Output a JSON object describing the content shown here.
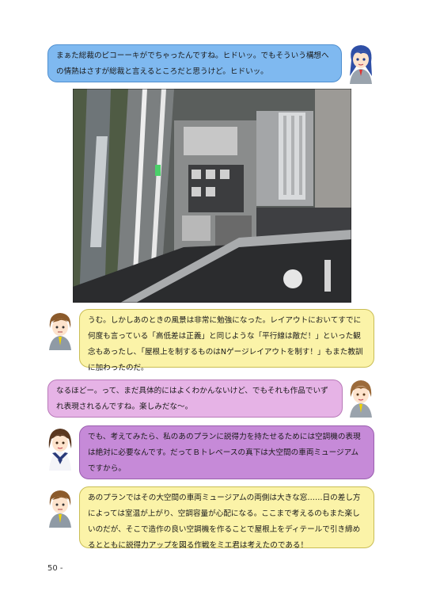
{
  "dialogs": [
    {
      "id": "d1",
      "text": "まぁた総裁のピコーーキがでちゃったんですね。ヒドいッ。でもそういう構想への情熱はさすが総裁と言えるところだと思うけど。ヒドいッ。",
      "speaker": "blue-hair-girl"
    },
    {
      "id": "d2",
      "text": "うむ。しかしあのときの風景は非常に勉強になった。レイアウトにおいてすでに何度も言っている「高低差は正義」と同じような「平行線は敵だ！」といった観念もあったし、「屋根上を制するものはNゲージレイアウトを制す！」もまた教訓に加わったのだ。",
      "speaker": "brown-hair-man"
    },
    {
      "id": "d3",
      "text": "なるほどー。って、まだ具体的にはよくわかんないけど、でもそれも作品でいずれ表現されるんですね。楽しみだな〜。",
      "speaker": "short-hair-girl"
    },
    {
      "id": "d4",
      "text": "でも、考えてみたら、私のあのプランに説得力を持たせるためには空調機の表現は絶対に必要なんです。だってＢトレベースの真下は大空間の車両ミュージアムですから。",
      "speaker": "sailor-uniform-girl"
    },
    {
      "id": "d5",
      "text": "あのプランではその大空間の車両ミュージアムの両側は大きな窓……日の差し方によっては室温が上がり、空調容量が心配になる。ここまで考えるのもまた楽しいのだが、そこで造作の良い空調機を作ることで屋根上をディテールで引き締めるとともに説得力アップを図る作戦をミエ君は考えたのである！",
      "speaker": "brown-hair-man"
    }
  ],
  "page_number": "50 -",
  "colors": {
    "blue": "#7fb9f0",
    "yellow": "#fbf3a8",
    "pink": "#e6b3e6",
    "purple": "#c68ad8"
  }
}
